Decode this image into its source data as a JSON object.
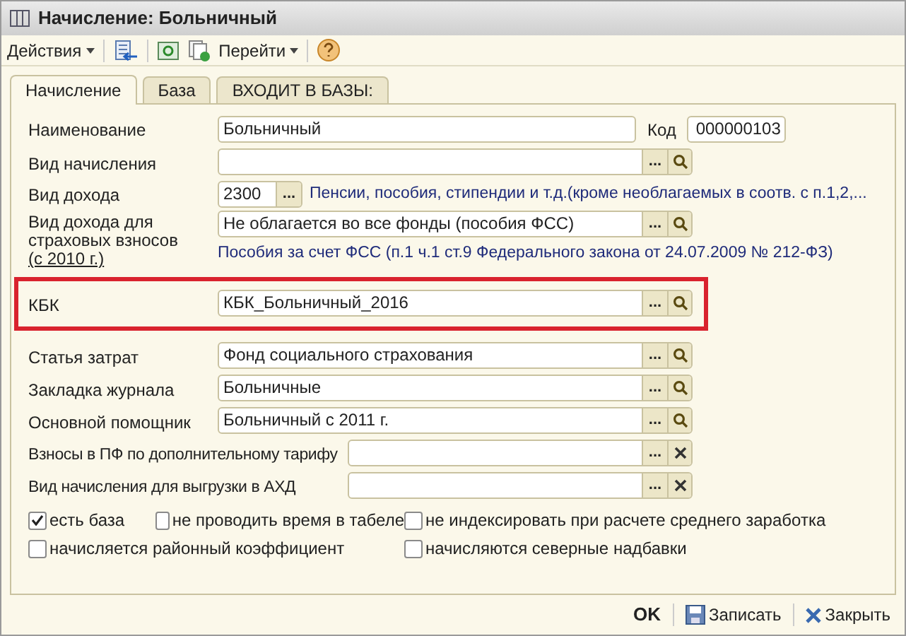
{
  "window": {
    "title": "Начисление: Больничный"
  },
  "toolbar": {
    "actions": "Действия",
    "goto": "Перейти"
  },
  "tabs": [
    {
      "label": "Начисление",
      "selected": true
    },
    {
      "label": "База",
      "selected": false
    },
    {
      "label": "ВХОДИТ В БАЗЫ:",
      "selected": false
    }
  ],
  "fields": [
    {
      "kind": "name",
      "label": "Наименование",
      "value": "Больничный",
      "code_label": "Код",
      "code": "000000103"
    },
    {
      "kind": "lookup",
      "label": "Вид начисления",
      "select_button": "..."
    },
    {
      "kind": "code",
      "label": "Вид дохода",
      "value": "2300",
      "select_button": "...",
      "description": "Пенсии, пособия, стипендии и т.д.(кроме необлагаемых в соотв. с п.1,2,..."
    },
    {
      "kind": "lookup",
      "label": "Вид дохода для страховых взносов",
      "label_link": "(с 2010 г.)",
      "value": "Не облагается во все фонды (пособия ФСС)",
      "select_button": "...",
      "description": "Пособия за счет ФСС (п.1 ч.1 ст.9 Федерального закона от 24.07.2009  № 212-ФЗ)"
    },
    {
      "kind": "lookup",
      "label": "КБК",
      "value": "КБК_Больничный_2016",
      "select_button": "...",
      "highlighted": true
    },
    {
      "kind": "lookup",
      "label": "Статья затрат",
      "value": "Фонд социального страхования",
      "select_button": "..."
    },
    {
      "kind": "lookup",
      "label": "Закладка журнала",
      "value": "Больничные",
      "select_button": "..."
    },
    {
      "kind": "lookup",
      "label": "Основной помощник",
      "value": "Больничный с 2011 г.",
      "select_button": "..."
    },
    {
      "kind": "clear",
      "label": "Взносы в ПФ по дополнительному тарифу",
      "select_button": "..."
    },
    {
      "kind": "clear",
      "label": "Вид начисления для выгрузки в АХД",
      "select_button": "..."
    }
  ],
  "checkbox_rows": [
    [
      {
        "label": "есть база",
        "checked": true
      },
      {
        "label": "не проводить время в табеле",
        "checked": false
      },
      {
        "label": "не индексировать при расчете среднего заработка",
        "checked": false
      }
    ],
    [
      {
        "label": "начисляется районный коэффициент",
        "checked": false,
        "kind": "wide"
      },
      {
        "label": "начисляются северные надбавки",
        "checked": false
      }
    ]
  ],
  "footer": {
    "ok": "OK",
    "save": "Записать",
    "close": "Закрыть"
  }
}
